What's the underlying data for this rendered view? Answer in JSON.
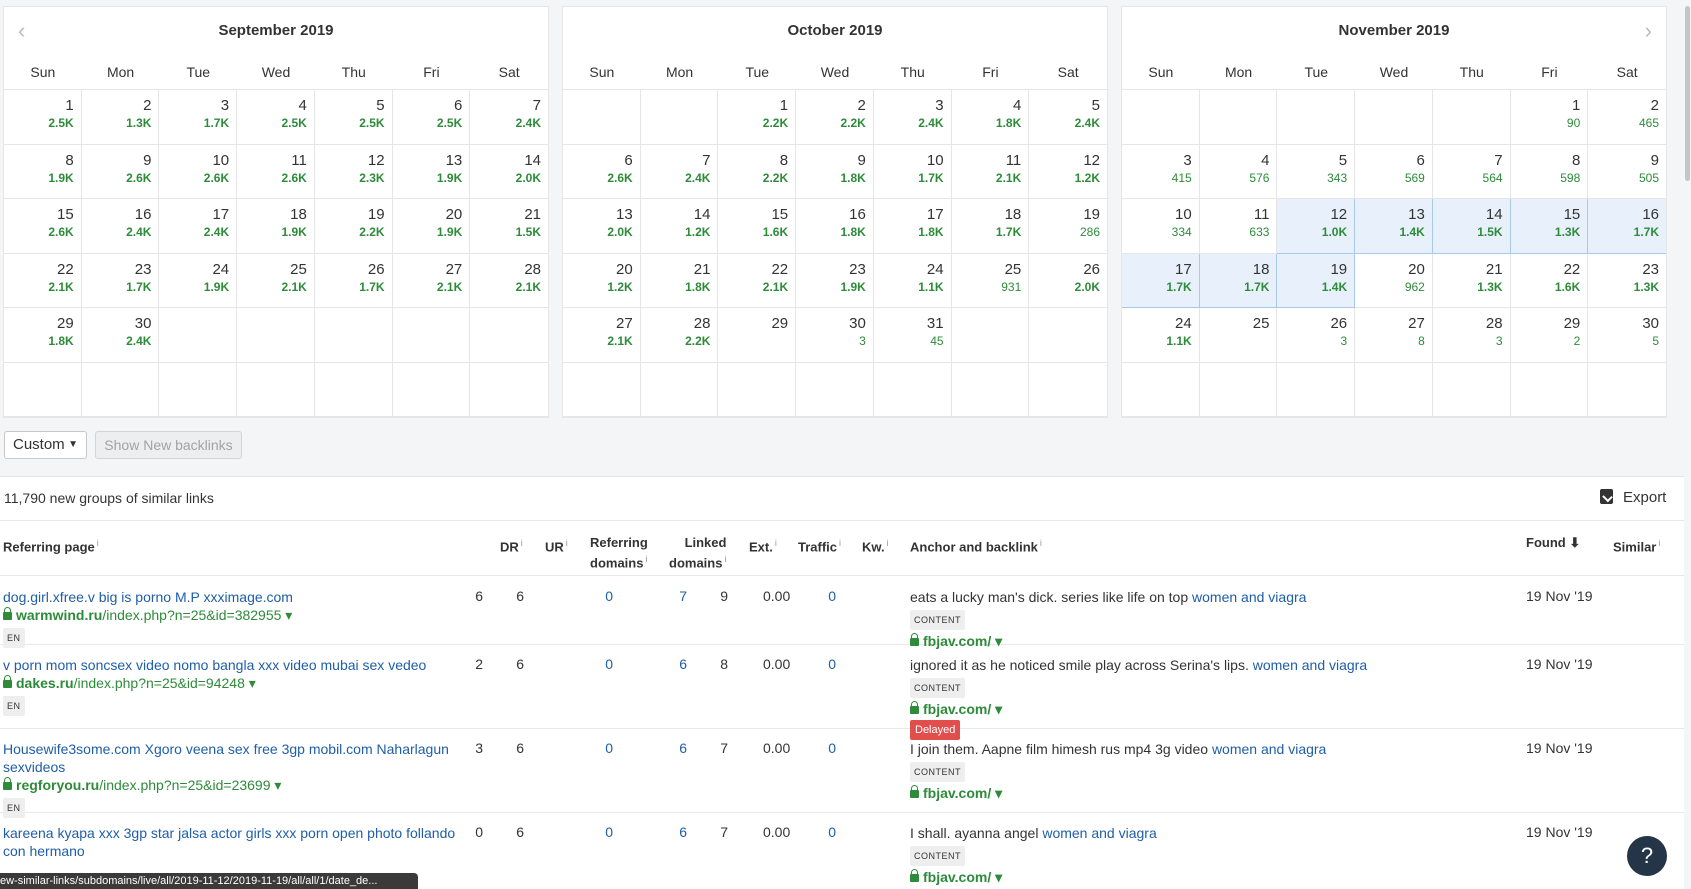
{
  "calendars": [
    {
      "title": "September 2019",
      "cells": [
        {
          "d": "1",
          "c": "2.5K"
        },
        {
          "d": "2",
          "c": "1.3K"
        },
        {
          "d": "3",
          "c": "1.7K"
        },
        {
          "d": "4",
          "c": "2.5K"
        },
        {
          "d": "5",
          "c": "2.5K"
        },
        {
          "d": "6",
          "c": "2.5K"
        },
        {
          "d": "7",
          "c": "2.4K"
        },
        {
          "d": "8",
          "c": "1.9K"
        },
        {
          "d": "9",
          "c": "2.6K"
        },
        {
          "d": "10",
          "c": "2.6K"
        },
        {
          "d": "11",
          "c": "2.6K"
        },
        {
          "d": "12",
          "c": "2.3K"
        },
        {
          "d": "13",
          "c": "1.9K"
        },
        {
          "d": "14",
          "c": "2.0K"
        },
        {
          "d": "15",
          "c": "2.6K"
        },
        {
          "d": "16",
          "c": "2.4K"
        },
        {
          "d": "17",
          "c": "2.4K"
        },
        {
          "d": "18",
          "c": "1.9K"
        },
        {
          "d": "19",
          "c": "2.2K"
        },
        {
          "d": "20",
          "c": "1.9K"
        },
        {
          "d": "21",
          "c": "1.5K"
        },
        {
          "d": "22",
          "c": "2.1K"
        },
        {
          "d": "23",
          "c": "1.7K"
        },
        {
          "d": "24",
          "c": "1.9K"
        },
        {
          "d": "25",
          "c": "2.1K"
        },
        {
          "d": "26",
          "c": "1.7K"
        },
        {
          "d": "27",
          "c": "2.1K"
        },
        {
          "d": "28",
          "c": "2.1K"
        },
        {
          "d": "29",
          "c": "1.8K"
        },
        {
          "d": "30",
          "c": "2.4K"
        },
        {
          "d": "",
          "c": ""
        },
        {
          "d": "",
          "c": ""
        },
        {
          "d": "",
          "c": ""
        },
        {
          "d": "",
          "c": ""
        },
        {
          "d": "",
          "c": ""
        },
        {
          "d": "",
          "c": ""
        },
        {
          "d": "",
          "c": ""
        },
        {
          "d": "",
          "c": ""
        },
        {
          "d": "",
          "c": ""
        },
        {
          "d": "",
          "c": ""
        },
        {
          "d": "",
          "c": ""
        },
        {
          "d": "",
          "c": ""
        }
      ]
    },
    {
      "title": "October 2019",
      "cells": [
        {
          "d": "",
          "c": ""
        },
        {
          "d": "",
          "c": ""
        },
        {
          "d": "1",
          "c": "2.2K"
        },
        {
          "d": "2",
          "c": "2.2K"
        },
        {
          "d": "3",
          "c": "2.4K"
        },
        {
          "d": "4",
          "c": "1.8K"
        },
        {
          "d": "5",
          "c": "2.4K"
        },
        {
          "d": "6",
          "c": "2.6K"
        },
        {
          "d": "7",
          "c": "2.4K"
        },
        {
          "d": "8",
          "c": "2.2K"
        },
        {
          "d": "9",
          "c": "1.8K"
        },
        {
          "d": "10",
          "c": "1.7K"
        },
        {
          "d": "11",
          "c": "2.1K"
        },
        {
          "d": "12",
          "c": "1.2K"
        },
        {
          "d": "13",
          "c": "2.0K"
        },
        {
          "d": "14",
          "c": "1.2K"
        },
        {
          "d": "15",
          "c": "1.6K"
        },
        {
          "d": "16",
          "c": "1.8K"
        },
        {
          "d": "17",
          "c": "1.8K"
        },
        {
          "d": "18",
          "c": "1.7K"
        },
        {
          "d": "19",
          "c": "286",
          "low": true
        },
        {
          "d": "20",
          "c": "1.2K"
        },
        {
          "d": "21",
          "c": "1.8K"
        },
        {
          "d": "22",
          "c": "2.1K"
        },
        {
          "d": "23",
          "c": "1.9K"
        },
        {
          "d": "24",
          "c": "1.1K"
        },
        {
          "d": "25",
          "c": "931",
          "low": true
        },
        {
          "d": "26",
          "c": "2.0K"
        },
        {
          "d": "27",
          "c": "2.1K"
        },
        {
          "d": "28",
          "c": "2.2K"
        },
        {
          "d": "29",
          "c": ""
        },
        {
          "d": "30",
          "c": "3",
          "low": true
        },
        {
          "d": "31",
          "c": "45",
          "low": true
        },
        {
          "d": "",
          "c": ""
        },
        {
          "d": "",
          "c": ""
        },
        {
          "d": "",
          "c": ""
        },
        {
          "d": "",
          "c": ""
        },
        {
          "d": "",
          "c": ""
        },
        {
          "d": "",
          "c": ""
        },
        {
          "d": "",
          "c": ""
        },
        {
          "d": "",
          "c": ""
        },
        {
          "d": "",
          "c": ""
        }
      ]
    },
    {
      "title": "November 2019",
      "cells": [
        {
          "d": "",
          "c": ""
        },
        {
          "d": "",
          "c": ""
        },
        {
          "d": "",
          "c": ""
        },
        {
          "d": "",
          "c": ""
        },
        {
          "d": "",
          "c": ""
        },
        {
          "d": "1",
          "c": "90",
          "low": true
        },
        {
          "d": "2",
          "c": "465",
          "low": true
        },
        {
          "d": "3",
          "c": "415",
          "low": true
        },
        {
          "d": "4",
          "c": "576",
          "low": true
        },
        {
          "d": "5",
          "c": "343",
          "low": true
        },
        {
          "d": "6",
          "c": "569",
          "low": true
        },
        {
          "d": "7",
          "c": "564",
          "low": true
        },
        {
          "d": "8",
          "c": "598",
          "low": true
        },
        {
          "d": "9",
          "c": "505",
          "low": true
        },
        {
          "d": "10",
          "c": "334",
          "low": true
        },
        {
          "d": "11",
          "c": "633",
          "low": true
        },
        {
          "d": "12",
          "c": "1.0K",
          "sel": true
        },
        {
          "d": "13",
          "c": "1.4K",
          "sel": true
        },
        {
          "d": "14",
          "c": "1.5K",
          "sel": true
        },
        {
          "d": "15",
          "c": "1.3K",
          "sel": true
        },
        {
          "d": "16",
          "c": "1.7K",
          "sel": true
        },
        {
          "d": "17",
          "c": "1.7K",
          "sel": true
        },
        {
          "d": "18",
          "c": "1.7K",
          "sel": true
        },
        {
          "d": "19",
          "c": "1.4K",
          "sel": true
        },
        {
          "d": "20",
          "c": "962",
          "low": true
        },
        {
          "d": "21",
          "c": "1.3K"
        },
        {
          "d": "22",
          "c": "1.6K"
        },
        {
          "d": "23",
          "c": "1.3K"
        },
        {
          "d": "24",
          "c": "1.1K"
        },
        {
          "d": "25",
          "c": ""
        },
        {
          "d": "26",
          "c": "3",
          "low": true
        },
        {
          "d": "27",
          "c": "8",
          "low": true
        },
        {
          "d": "28",
          "c": "3",
          "low": true
        },
        {
          "d": "29",
          "c": "2",
          "low": true
        },
        {
          "d": "30",
          "c": "5",
          "low": true
        },
        {
          "d": "",
          "c": ""
        },
        {
          "d": "",
          "c": ""
        },
        {
          "d": "",
          "c": ""
        },
        {
          "d": "",
          "c": ""
        },
        {
          "d": "",
          "c": ""
        },
        {
          "d": "",
          "c": ""
        },
        {
          "d": "",
          "c": ""
        }
      ]
    }
  ],
  "weekdays": [
    "Sun",
    "Mon",
    "Tue",
    "Wed",
    "Thu",
    "Fri",
    "Sat"
  ],
  "nav": {
    "prev": "‹",
    "next": "›"
  },
  "controls": {
    "range_select": "Custom",
    "range_caret": "▼",
    "show_new_button": "Show New backlinks"
  },
  "summary": {
    "count_text": "11,790 new groups of similar links",
    "export_label": "Export"
  },
  "columns": {
    "referring_page": "Referring page",
    "dr": "DR",
    "ur": "UR",
    "ref_domains_1": "Referring",
    "ref_domains_2": "domains",
    "linked_domains_1": "Linked",
    "linked_domains_2": "domains",
    "ext": "Ext.",
    "traffic": "Traffic",
    "kw": "Kw.",
    "anchor": "Anchor and backlink",
    "found": "Found ⬇",
    "similar": "Similar",
    "info": "i"
  },
  "rows": [
    {
      "title": "dog.girl.xfree.v big is porno M.P xxximage.com",
      "domain": "warmwind.ru",
      "path": "/index.php?n=25&id=382955 ▾",
      "lang": "EN",
      "dr": "6",
      "ur": "6",
      "ref": "0",
      "linked": "7",
      "ext": "9",
      "traffic": "0.00",
      "kw": "0",
      "anchor_text": "eats a lucky man's dick. series like life on top ",
      "anchor_kw": "women and viagra",
      "type": "CONTENT",
      "target": "fbjav.com/ ▾",
      "delayed": "",
      "found": "19 Nov '19"
    },
    {
      "title": "v porn mom soncsex video nomo bangla xxx video mubai sex vedeo",
      "domain": "dakes.ru",
      "path": "/index.php?n=25&id=94248 ▾",
      "lang": "EN",
      "dr": "2",
      "ur": "6",
      "ref": "0",
      "linked": "6",
      "ext": "8",
      "traffic": "0.00",
      "kw": "0",
      "anchor_text": "ignored it as he noticed smile play across Serina's lips. ",
      "anchor_kw": "women and viagra",
      "type": "CONTENT",
      "target": "fbjav.com/ ▾",
      "delayed": "Delayed",
      "found": "19 Nov '19"
    },
    {
      "title": "Housewife3some.com Xgoro veena sex free 3gp mobil.com Naharlagun sexvideos",
      "domain": "regforyou.ru",
      "path": "/index.php?n=25&id=23699 ▾",
      "lang": "EN",
      "dr": "3",
      "ur": "6",
      "ref": "0",
      "linked": "6",
      "ext": "7",
      "traffic": "0.00",
      "kw": "0",
      "anchor_text": "I join them. Aapne film himesh rus mp4 3g video ",
      "anchor_kw": "women and viagra",
      "type": "CONTENT",
      "target": "fbjav.com/ ▾",
      "delayed": "",
      "found": "19 Nov '19"
    },
    {
      "title": "kareena kyapa xxx 3gp star jalsa actor girls xxx porn open photo follando con hermano",
      "domain": "",
      "path": "",
      "lang": "",
      "dr": "0",
      "ur": "6",
      "ref": "0",
      "linked": "6",
      "ext": "7",
      "traffic": "0.00",
      "kw": "0",
      "anchor_text": "I shall. ayanna angel ",
      "anchor_kw": "women and viagra",
      "type": "CONTENT",
      "target": "fbjav.com/ ▾",
      "delayed": "",
      "found": "19 Nov '19"
    }
  ],
  "help_label": "?",
  "status_url": "ew-similar-links/subdomains/live/all/2019-11-12/2019-11-19/all/all/1/date_de..."
}
